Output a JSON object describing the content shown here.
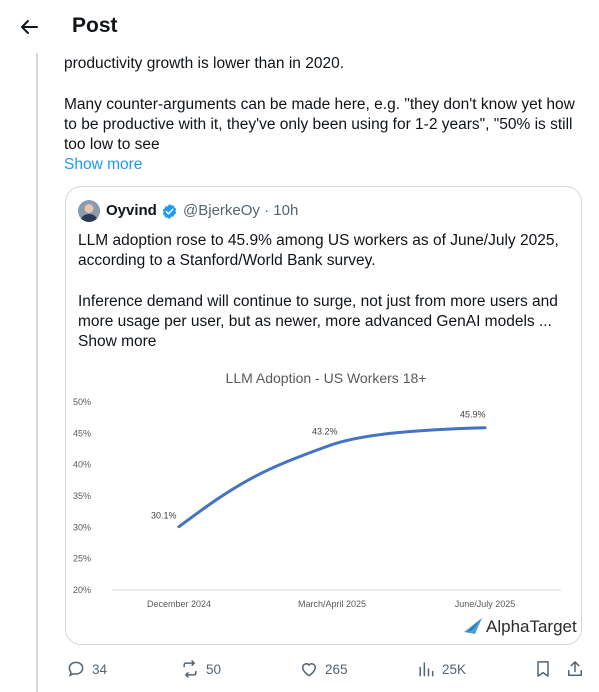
{
  "header": {
    "title": "Post"
  },
  "post": {
    "line1": "productivity growth is lower than in 2020.",
    "line2": "Many counter-arguments can be made here, e.g. \"they don't know yet how",
    "line3": "to be productive with it, they've only been using for 1-2 years\", \"50% is still",
    "line4": "too low to see",
    "show_more": "Show more"
  },
  "quote": {
    "name": "Oyvind",
    "handle": "@BjerkeOy",
    "time": "· 10h",
    "text1": "LLM adoption rose to 45.9% among US workers as of June/July 2025,",
    "text2": "according to a Stanford/World Bank survey.",
    "text3": "Inference demand will continue to surge, not just from more users and",
    "text4": "more usage per user, but as newer, more advanced GenAI models ...",
    "show_more": "Show more"
  },
  "chart_data": {
    "type": "line",
    "title": "LLM Adoption - US Workers 18+",
    "categories": [
      "December 2024",
      "March/April 2025",
      "June/July 2025"
    ],
    "series": [
      {
        "values": [
          30.1,
          43.2,
          45.9
        ]
      }
    ],
    "data_labels": [
      "30.1%",
      "43.2%",
      "45.9%"
    ],
    "y_ticks": [
      "50%",
      "45%",
      "40%",
      "35%",
      "30%",
      "25%",
      "20%"
    ],
    "ylim": [
      20,
      50
    ],
    "line_color": "#4472c4",
    "grid": false,
    "brand": "AlphaTarget"
  },
  "actions": {
    "replies": "34",
    "reposts": "50",
    "likes": "265",
    "views": "25K"
  },
  "colors": {
    "accent": "#1d9bf0",
    "muted": "#536471",
    "border": "#cfd9de"
  }
}
